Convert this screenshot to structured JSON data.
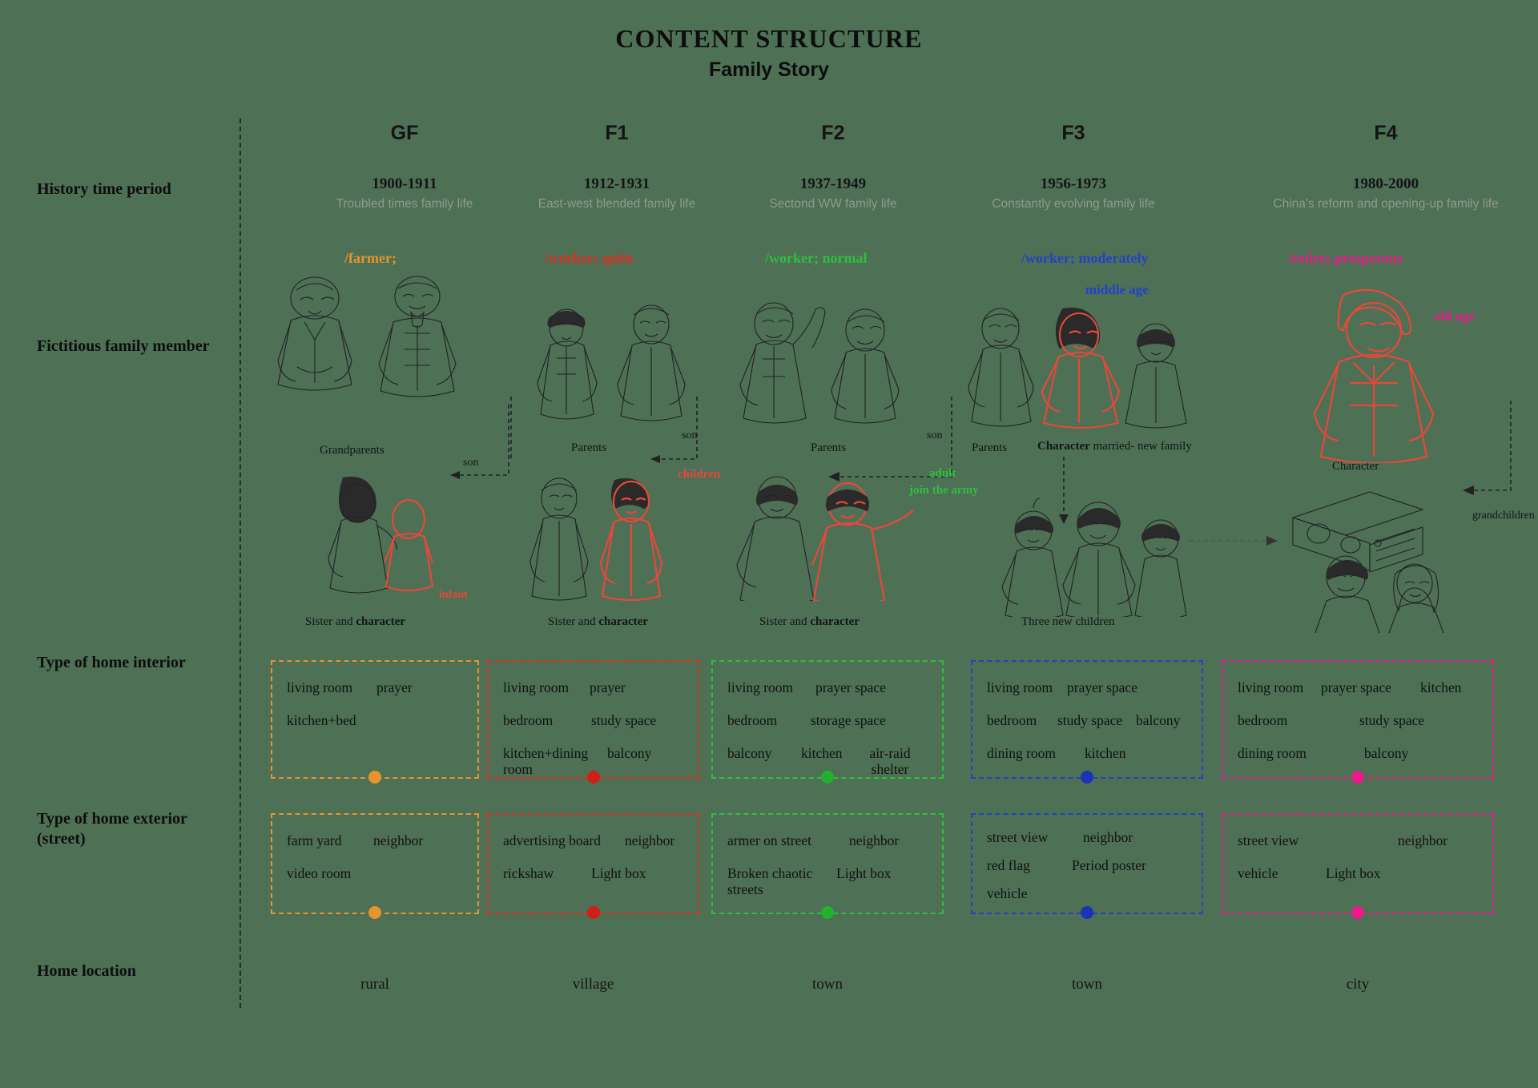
{
  "title": {
    "main": "CONTENT STRUCTURE",
    "sub": "Family Story"
  },
  "row_labels": {
    "history": "History time period",
    "family_member": "Fictitious family member",
    "home_interior": "Type of home interior",
    "home_exterior_l1": "Type of home exterior",
    "home_exterior_l2": "(street)",
    "home_location": "Home location"
  },
  "colors": {
    "gf": "#e8942e",
    "f1": "#e02d20",
    "f2": "#2fbf3f",
    "f3": "#2342c8",
    "f4": "#ec1a8b",
    "background": "#4e7055",
    "text": "#111111",
    "muted": "#8e9b8e"
  },
  "columns": [
    {
      "code": "GF",
      "years": "1900-1911",
      "desc": "Troubled times family life",
      "occupation": "/farmer;",
      "occupation_color": "#e8942e",
      "accent": "#e8942e",
      "interior": [
        [
          "living room",
          "prayer"
        ],
        [
          "kitchen+bed"
        ],
        []
      ],
      "exterior": [
        [
          "farm yard",
          "neighbor"
        ],
        [
          "video room"
        ]
      ],
      "location": "rural",
      "figure_caption_top": "Grandparents",
      "figure_caption_bottom": "Sister and character",
      "figure_caption_bottom_bold": "character",
      "relation_label": "son",
      "extra_label": "infant",
      "extra_label_color": "#e02d20"
    },
    {
      "code": "F1",
      "years": "1912-1931",
      "desc": "East-west blended family life",
      "occupation": "/worker; quite",
      "occupation_color": "#e02d20",
      "accent": "#e02d20",
      "interior": [
        [
          "living room",
          "prayer"
        ],
        [
          "bedroom",
          "study space"
        ],
        [
          "kitchen+dining room",
          "balcony"
        ]
      ],
      "exterior": [
        [
          "advertising board",
          "neighbor"
        ],
        [
          "rickshaw",
          "Light box"
        ]
      ],
      "location": "village",
      "figure_caption_top": "Parents",
      "figure_caption_bottom": "Sister and character",
      "figure_caption_bottom_bold": "character",
      "relation_label": "son",
      "extra_label": "children",
      "extra_label_color": "#e02d20"
    },
    {
      "code": "F2",
      "years": "1937-1949",
      "desc": "Sectond WW family life",
      "occupation": "/worker; normal",
      "occupation_color": "#2fbf3f",
      "accent": "#2fbf3f",
      "interior": [
        [
          "living room",
          "prayer space"
        ],
        [
          "bedroom",
          "storage space"
        ],
        [
          "balcony",
          "kitchen",
          "air-raid shelter"
        ]
      ],
      "exterior": [
        [
          "armer on street",
          "neighbor"
        ],
        [
          "Broken chaotic streets",
          "Light box"
        ]
      ],
      "location": "town",
      "figure_caption_top": "Parents",
      "figure_caption_bottom": "Sister and character",
      "figure_caption_bottom_bold": "character",
      "relation_label": "son",
      "extra_label": "adult join the army",
      "extra_label_color": "#2fbf3f"
    },
    {
      "code": "F3",
      "years": "1956-1973",
      "desc": "Constantly evolving family life",
      "occupation": "/worker; moderately",
      "occupation_color": "#2342c8",
      "accent": "#2342c8",
      "age_label": "middle age",
      "age_label_color": "#2342c8",
      "interior": [
        [
          "living room",
          "prayer space"
        ],
        [
          "bedroom",
          "study space",
          "balcony"
        ],
        [
          "dining room",
          "kitchen"
        ]
      ],
      "exterior": [
        [
          "street view",
          "neighbor"
        ],
        [
          "red flag",
          "Period poster"
        ],
        [
          "vehicle"
        ]
      ],
      "location": "town",
      "figure_caption_top": "Parents",
      "figure_caption_marriage": "Character married- new family",
      "figure_caption_marriage_bold": "Character",
      "figure_caption_bottom": "Three new children"
    },
    {
      "code": "F4",
      "years": "1980-2000",
      "desc": "China's reform and opening-up family life",
      "occupation": "/retire; prosperous",
      "occupation_color": "#ec1a8b",
      "accent": "#ec1a8b",
      "age_label": "old age",
      "age_label_color": "#ec1a8b",
      "interior": [
        [
          "living room",
          "prayer space",
          "kitchen"
        ],
        [
          "bedroom",
          "study space"
        ],
        [
          "dining room",
          "balcony"
        ]
      ],
      "exterior": [
        [
          "street view",
          "neighbor"
        ],
        [
          "vehicle",
          "Light box"
        ]
      ],
      "location": "city",
      "figure_caption_top": "Character",
      "extra_label": "grandchildren"
    }
  ],
  "interior_text": {
    "gf": {
      "r1c1": "living room",
      "r1c2": "prayer",
      "r2c1": "kitchen+bed"
    },
    "f1": {
      "r1c1": "living room",
      "r1c2": "prayer",
      "r2c1": "bedroom",
      "r2c2": "study space",
      "r3c1": "kitchen+dining room",
      "r3c2": "balcony"
    },
    "f2": {
      "r1c1": "living room",
      "r1c2": "prayer space",
      "r2c1": "bedroom",
      "r2c2": "storage space",
      "r3c1": "balcony",
      "r3c2": "kitchen",
      "r3c3": "air-raid shelter"
    },
    "f3": {
      "r1c1": "living room",
      "r1c2": "prayer space",
      "r2c1": "bedroom",
      "r2c2": "study space",
      "r2c3": "balcony",
      "r3c1": "dining room",
      "r3c2": "kitchen"
    },
    "f4": {
      "r1c1": "living room",
      "r1c2": "prayer space",
      "r1c3": "kitchen",
      "r2c1": "bedroom",
      "r2c2": "study space",
      "r3c1": "dining room",
      "r3c2": "balcony"
    }
  },
  "exterior_text": {
    "gf": {
      "r1c1": "farm yard",
      "r1c2": "neighbor",
      "r2c1": "video room"
    },
    "f1": {
      "r1c1": "advertising board",
      "r1c2": "neighbor",
      "r2c1": "rickshaw",
      "r2c2": "Light box"
    },
    "f2": {
      "r1c1": "armer on street",
      "r1c2": "neighbor",
      "r2c1": "Broken chaotic streets",
      "r2c2": "Light box"
    },
    "f3": {
      "r1c1": "street view",
      "r1c2": "neighbor",
      "r2c1": "red flag",
      "r2c2": "Period poster",
      "r3c1": "vehicle"
    },
    "f4": {
      "r1c1": "street view",
      "r1c2": "neighbor",
      "r2c1": "vehicle",
      "r2c2": "Light box"
    }
  },
  "figure_labels": {
    "grandparents": "Grandparents",
    "parents_f1": "Parents",
    "parents_f2": "Parents",
    "parents_f3": "Parents",
    "son_gf": "son",
    "son_f1": "son",
    "son_f2": "son",
    "children_f1": "children",
    "infant_gf": "infant",
    "adult_f2_l1": "adult",
    "adult_f2_l2": "join the army",
    "married_f3_bold": "Character",
    "married_f3_rest": " married- new family",
    "three_children_f3": "Three new children",
    "character_f4": "Character",
    "grandchildren_f4": "grandchildren",
    "sister_and": "Sister and ",
    "character": "character"
  },
  "locations": {
    "gf": "rural",
    "f1": "village",
    "f2": "town",
    "f3": "town",
    "f4": "city"
  }
}
